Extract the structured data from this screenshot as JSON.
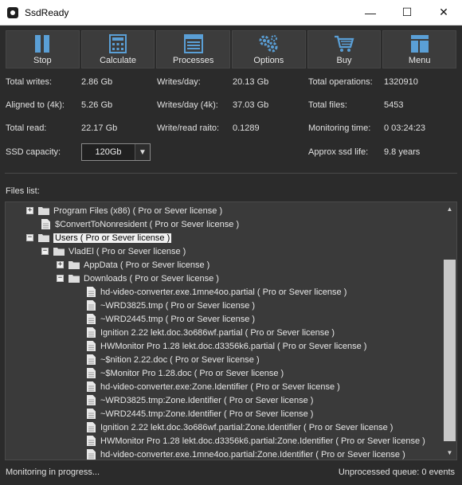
{
  "window": {
    "title": "SsdReady"
  },
  "title_controls": {
    "minimize": "—",
    "maximize": "☐",
    "close": "✕"
  },
  "toolbar": {
    "buttons": [
      {
        "label": "Stop",
        "icon": "pause-icon"
      },
      {
        "label": "Calculate",
        "icon": "calculator-icon"
      },
      {
        "label": "Processes",
        "icon": "list-icon"
      },
      {
        "label": "Options",
        "icon": "gears-icon"
      },
      {
        "label": "Buy",
        "icon": "cart-icon"
      },
      {
        "label": "Menu",
        "icon": "menu-icon"
      }
    ]
  },
  "stats": {
    "total_writes_label": "Total writes:",
    "total_writes": "2.86 Gb",
    "writes_day_label": "Writes/day:",
    "writes_day": "20.13 Gb",
    "total_operations_label": "Total operations:",
    "total_operations": "1320910",
    "aligned_label": "Aligned to (4k):",
    "aligned": "5.26 Gb",
    "writes_day_4k_label": "Writes/day (4k):",
    "writes_day_4k": "37.03 Gb",
    "total_files_label": "Total files:",
    "total_files": "5453",
    "total_read_label": "Total read:",
    "total_read": "22.17 Gb",
    "wr_ratio_label": "Write/read raito:",
    "wr_ratio": "0.1289",
    "monitoring_time_label": "Monitoring time:",
    "monitoring_time": "0 03:24:23",
    "ssd_capacity_label": "SSD capacity:",
    "ssd_capacity": "120Gb",
    "approx_life_label": "Approx ssd life:",
    "approx_life": "9.8 years"
  },
  "files": {
    "label": "Files list:",
    "rows": [
      {
        "text": "Program Files (x86) ( Pro or Sever license )"
      },
      {
        "text": "$ConvertToNonresident ( Pro or Sever license )"
      },
      {
        "text": "Users ( Pro or Sever license )"
      },
      {
        "text": "VladEl ( Pro or Sever license )"
      },
      {
        "text": "AppData ( Pro or Sever license )"
      },
      {
        "text": "Downloads ( Pro or Sever license )"
      },
      {
        "text": "hd-video-converter.exe.1mne4oo.partial ( Pro or Sever license )"
      },
      {
        "text": "~WRD3825.tmp ( Pro or Sever license )"
      },
      {
        "text": "~WRD2445.tmp ( Pro or Sever license )"
      },
      {
        "text": "Ignition 2.22 lekt.doc.3o686wf.partial ( Pro or Sever license )"
      },
      {
        "text": "HWMonitor Pro 1.28 lekt.doc.d3356k6.partial ( Pro or Sever license )"
      },
      {
        "text": "~$nition 2.22.doc ( Pro or Sever license )"
      },
      {
        "text": "~$Monitor Pro 1.28.doc ( Pro or Sever license )"
      },
      {
        "text": "hd-video-converter.exe:Zone.Identifier ( Pro or Sever license )"
      },
      {
        "text": "~WRD3825.tmp:Zone.Identifier ( Pro or Sever license )"
      },
      {
        "text": "~WRD2445.tmp:Zone.Identifier ( Pro or Sever license )"
      },
      {
        "text": "Ignition 2.22 lekt.doc.3o686wf.partial:Zone.Identifier ( Pro or Sever license )"
      },
      {
        "text": "HWMonitor Pro 1.28 lekt.doc.d3356k6.partial:Zone.Identifier ( Pro or Sever license )"
      },
      {
        "text": "hd-video-converter.exe.1mne4oo.partial:Zone.Identifier ( Pro or Sever license )"
      }
    ]
  },
  "status": {
    "left": "Monitoring in progress...",
    "right": "Unprocessed queue: 0 events"
  },
  "colors": {
    "background": "#2b2b2b",
    "panel": "#3a3a3a",
    "button": "#3c3c3c",
    "text": "#e6e6e6"
  }
}
